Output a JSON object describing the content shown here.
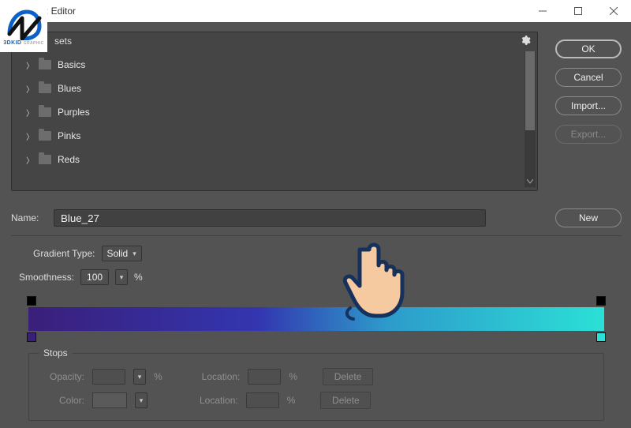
{
  "window": {
    "title": ": Editor"
  },
  "logo": {
    "line1": "3DKID",
    "line2": "GRAPHIC"
  },
  "presets": {
    "label": "sets",
    "folders": [
      "Basics",
      "Blues",
      "Purples",
      "Pinks",
      "Reds"
    ]
  },
  "buttons": {
    "ok": "OK",
    "cancel": "Cancel",
    "import": "Import...",
    "export": "Export...",
    "new": "New"
  },
  "name": {
    "label": "Name:",
    "value": "Blue_27"
  },
  "gradient": {
    "type_label": "Gradient Type:",
    "type_value": "Solid",
    "smoothness_label": "Smoothness:",
    "smoothness_value": "100",
    "percent": "%",
    "colors": {
      "start": "#3a1f7a",
      "end": "#2be0d6"
    }
  },
  "stops": {
    "title": "Stops",
    "opacity_label": "Opacity:",
    "color_label": "Color:",
    "location_label": "Location:",
    "delete_label": "Delete",
    "percent": "%"
  }
}
